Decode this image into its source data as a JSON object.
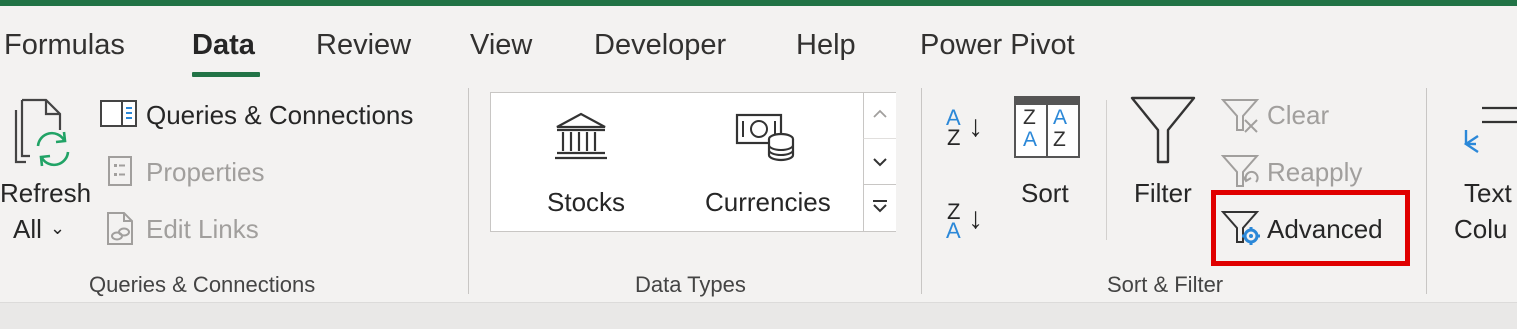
{
  "tabs": [
    "Formulas",
    "Data",
    "Review",
    "View",
    "Developer",
    "Help",
    "Power Pivot"
  ],
  "active_tab": "Data",
  "colors": {
    "accent": "#217346",
    "highlight": "#e00000",
    "blue": "#2b88d8"
  },
  "queries_group": {
    "refresh_line1": "Refresh",
    "refresh_line2": "All",
    "queries_connections": "Queries & Connections",
    "properties": "Properties",
    "edit_links": "Edit Links",
    "label": "Queries & Connections"
  },
  "data_types_group": {
    "stocks": "Stocks",
    "currencies": "Currencies",
    "label": "Data Types"
  },
  "sort_filter_group": {
    "sort": "Sort",
    "filter": "Filter",
    "clear": "Clear",
    "reapply": "Reapply",
    "advanced": "Advanced",
    "label": "Sort & Filter",
    "az_top": "A",
    "az_bottom": "Z",
    "za_top": "Z",
    "za_bottom": "A",
    "sort_grid": [
      "Z",
      "A",
      "A",
      "Z"
    ]
  },
  "text_columns": {
    "line1": "Text",
    "line2": "Colu"
  }
}
